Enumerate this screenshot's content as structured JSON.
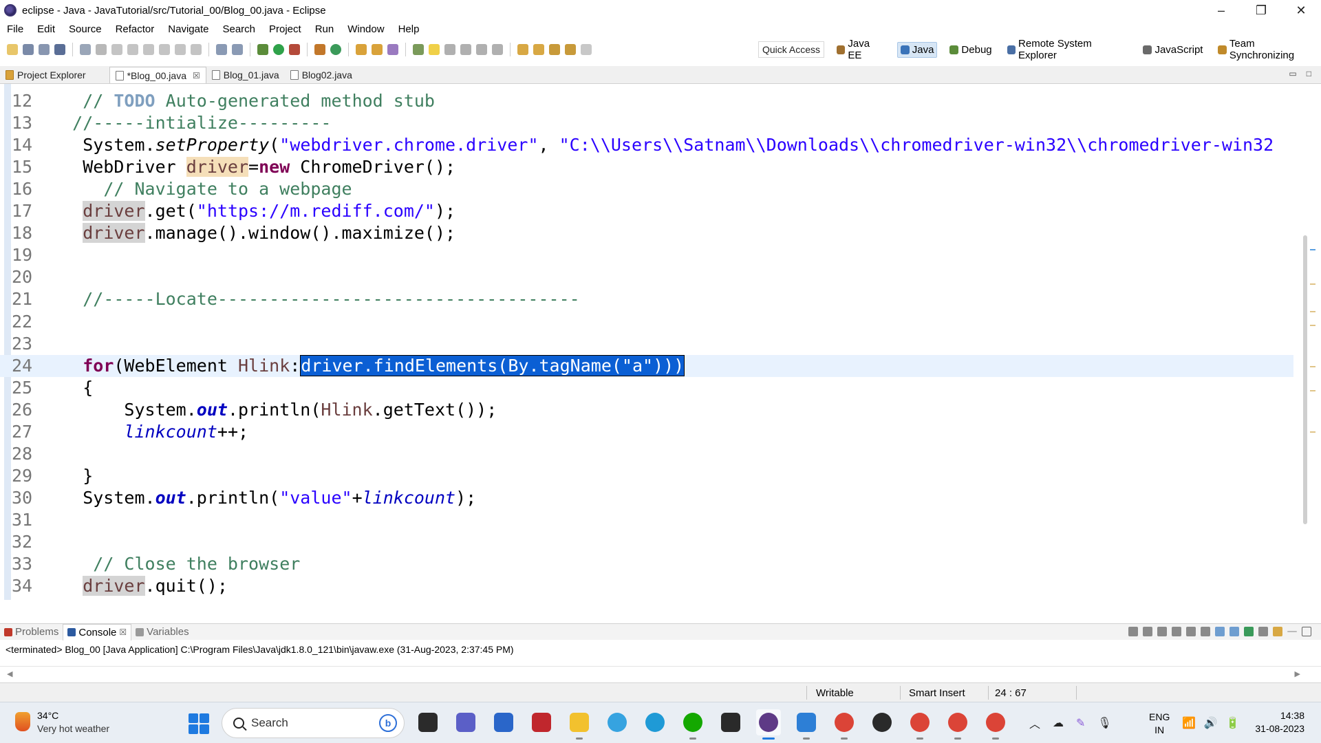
{
  "window": {
    "title": "eclipse - Java - JavaTutorial/src/Tutorial_00/Blog_00.java - Eclipse",
    "controls": [
      "–",
      "❐",
      "✕"
    ]
  },
  "menu": [
    "File",
    "Edit",
    "Source",
    "Refactor",
    "Navigate",
    "Search",
    "Project",
    "Run",
    "Window",
    "Help"
  ],
  "toolbar": {
    "quick_access": "Quick Access",
    "perspectives": [
      {
        "label": "Java EE",
        "color": "#a07030",
        "active": false
      },
      {
        "label": "Java",
        "color": "#3a73b9",
        "active": true
      },
      {
        "label": "Debug",
        "color": "#5b8c3a",
        "active": false
      },
      {
        "label": "Remote System Explorer",
        "color": "#4a6fa5",
        "active": false
      },
      {
        "label": "JavaScript",
        "color": "#6a6a6a",
        "active": false
      },
      {
        "label": "Team Synchronizing",
        "color": "#c08a2a",
        "active": false
      }
    ]
  },
  "tabs": [
    {
      "label": "Project Explorer",
      "closable": false,
      "active": false
    },
    {
      "label": "*Blog_00.java",
      "closable": true,
      "active": true
    },
    {
      "label": "Blog_01.java",
      "closable": false,
      "active": false
    },
    {
      "label": "Blog02.java",
      "closable": false,
      "active": false
    }
  ],
  "editor": {
    "current_line": 24,
    "lines": [
      {
        "num": "12",
        "segs": [
          {
            "t": "    "
          },
          {
            "t": "// ",
            "c": "c-comment"
          },
          {
            "t": "TODO",
            "c": "c-todo"
          },
          {
            "t": " Auto-generated method stub",
            "c": "c-comment"
          }
        ]
      },
      {
        "num": "13",
        "segs": [
          {
            "t": "   "
          },
          {
            "t": "//-----intialize---------",
            "c": "c-comment"
          }
        ]
      },
      {
        "num": "14",
        "segs": [
          {
            "t": "    System."
          },
          {
            "t": "setProperty",
            "c": "c-static"
          },
          {
            "t": "("
          },
          {
            "t": "\"webdriver.chrome.driver\"",
            "c": "c-string"
          },
          {
            "t": ", "
          },
          {
            "t": "\"C:\\\\Users\\\\Satnam\\\\Downloads\\\\chromedriver-win32\\\\chromedriver-win32",
            "c": "c-string"
          }
        ]
      },
      {
        "num": "15",
        "segs": [
          {
            "t": "    WebDriver "
          },
          {
            "t": "driver",
            "c": "c-var occ-w"
          },
          {
            "t": "="
          },
          {
            "t": "new",
            "c": "c-kw"
          },
          {
            "t": " ChromeDriver();"
          }
        ]
      },
      {
        "num": "16",
        "segs": [
          {
            "t": "      "
          },
          {
            "t": "// Navigate to a webpage",
            "c": "c-comment"
          }
        ]
      },
      {
        "num": "17",
        "segs": [
          {
            "t": "    "
          },
          {
            "t": "driver",
            "c": "c-var occ"
          },
          {
            "t": ".get("
          },
          {
            "t": "\"https://m.rediff.com/\"",
            "c": "c-string"
          },
          {
            "t": ");"
          }
        ]
      },
      {
        "num": "18",
        "segs": [
          {
            "t": "    "
          },
          {
            "t": "driver",
            "c": "c-var occ"
          },
          {
            "t": ".manage().window().maximize();"
          }
        ]
      },
      {
        "num": "19",
        "segs": []
      },
      {
        "num": "20",
        "segs": []
      },
      {
        "num": "21",
        "segs": [
          {
            "t": "    "
          },
          {
            "t": "//-----Locate-----------------------------------",
            "c": "c-comment"
          }
        ]
      },
      {
        "num": "22",
        "segs": []
      },
      {
        "num": "23",
        "segs": []
      },
      {
        "num": "24",
        "segs": [
          {
            "t": "    "
          },
          {
            "t": "for",
            "c": "c-kw"
          },
          {
            "t": "(WebElement "
          },
          {
            "t": "Hlink",
            "c": "c-var"
          },
          {
            "t": ":"
          },
          {
            "t": "driver.findElements(By.tagName(\"a\")))",
            "c": "sel"
          }
        ]
      },
      {
        "num": "25",
        "segs": [
          {
            "t": "    {"
          }
        ]
      },
      {
        "num": "26",
        "segs": [
          {
            "t": "        System."
          },
          {
            "t": "out",
            "c": "c-field c-kw-b"
          },
          {
            "t": ".println("
          },
          {
            "t": "Hlink",
            "c": "c-var"
          },
          {
            "t": ".getText());"
          }
        ]
      },
      {
        "num": "27",
        "segs": [
          {
            "t": "        "
          },
          {
            "t": "linkcount",
            "c": "c-field"
          },
          {
            "t": "++;"
          }
        ]
      },
      {
        "num": "28",
        "segs": []
      },
      {
        "num": "29",
        "segs": [
          {
            "t": "    }"
          }
        ]
      },
      {
        "num": "30",
        "segs": [
          {
            "t": "    System."
          },
          {
            "t": "out",
            "c": "c-field c-kw-b"
          },
          {
            "t": ".println("
          },
          {
            "t": "\"value\"",
            "c": "c-string"
          },
          {
            "t": "+"
          },
          {
            "t": "linkcount",
            "c": "c-field"
          },
          {
            "t": ");"
          }
        ]
      },
      {
        "num": "31",
        "segs": []
      },
      {
        "num": "32",
        "segs": []
      },
      {
        "num": "33",
        "segs": [
          {
            "t": "     "
          },
          {
            "t": "// Close the browser",
            "c": "c-comment"
          }
        ]
      },
      {
        "num": "34",
        "segs": [
          {
            "t": "    "
          },
          {
            "t": "driver",
            "c": "c-var occ"
          },
          {
            "t": ".quit();"
          }
        ]
      }
    ]
  },
  "console": {
    "tabs": [
      {
        "label": "Problems",
        "active": false,
        "color": "#c0392b"
      },
      {
        "label": "Console",
        "active": true,
        "color": "#2c5aa0"
      },
      {
        "label": "Variables",
        "active": false,
        "color": "#9a9a9a"
      }
    ],
    "status": "<terminated> Blog_00 [Java Application] C:\\Program Files\\Java\\jdk1.8.0_121\\bin\\javaw.exe (31-Aug-2023, 2:37:45 PM)"
  },
  "status": {
    "mode": "Writable",
    "insert": "Smart Insert",
    "position": "24 : 67"
  },
  "taskbar": {
    "weather_temp": "34°C",
    "weather_desc": "Very hot weather",
    "search_placeholder": "Search",
    "search_badge": "b",
    "apps": [
      {
        "name": "file-explorer-dark-app",
        "color": "#2b2b2b",
        "round": false,
        "active": false
      },
      {
        "name": "teams-chat-app",
        "color": "#5b5fc7",
        "round": false,
        "active": false
      },
      {
        "name": "store-app",
        "color": "#2a66c9",
        "round": false,
        "active": false
      },
      {
        "name": "mcafee-app",
        "color": "#c0272d",
        "round": false,
        "active": false
      },
      {
        "name": "folder-app",
        "color": "#f2c12e",
        "round": false,
        "active": false
      },
      {
        "name": "help-app",
        "color": "#36a3e0",
        "round": true,
        "active": false
      },
      {
        "name": "edge-app",
        "color": "#1f9ad6",
        "round": true,
        "active": false
      },
      {
        "name": "upwork-app",
        "color": "#14a800",
        "round": true,
        "active": false
      },
      {
        "name": "terminal-app",
        "color": "#2a2a2a",
        "round": false,
        "active": false
      },
      {
        "name": "eclipse-app",
        "color": "#5e3a86",
        "round": true,
        "active": true
      },
      {
        "name": "notepad-app",
        "color": "#2d7fd6",
        "round": false,
        "active": false
      },
      {
        "name": "chrome-app",
        "color": "#db4437",
        "round": true,
        "active": false
      },
      {
        "name": "obs-app",
        "color": "#2a2a2a",
        "round": true,
        "active": false
      },
      {
        "name": "chrome-app-2",
        "color": "#db4437",
        "round": true,
        "active": false
      },
      {
        "name": "chrome-app-3",
        "color": "#db4437",
        "round": true,
        "active": false
      },
      {
        "name": "chrome-app-4",
        "color": "#db4437",
        "round": true,
        "active": false
      }
    ],
    "lang_top": "ENG",
    "lang_bottom": "IN",
    "time": "14:38",
    "date": "31-08-2023"
  }
}
